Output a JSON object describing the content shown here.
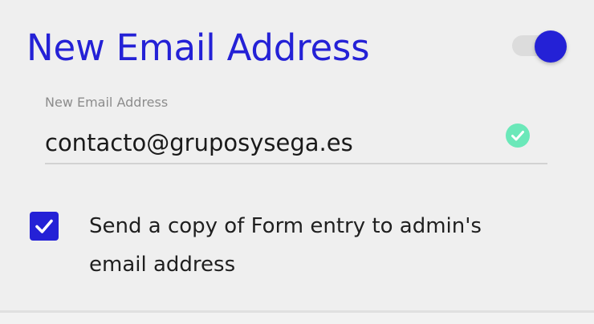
{
  "section": {
    "title": "New Email Address",
    "toggle_state": "on"
  },
  "email_field": {
    "label": "New Email Address",
    "value": "contacto@gruposysega.es",
    "status": "valid"
  },
  "copy_checkbox": {
    "checked": true,
    "label": "Send a copy of Form entry to admin's email address"
  },
  "colors": {
    "accent": "#2421d6",
    "valid": "#6be8b9",
    "background": "#efefef"
  },
  "icons": {
    "valid": "check-circle-icon",
    "checkbox": "checkmark-icon"
  }
}
